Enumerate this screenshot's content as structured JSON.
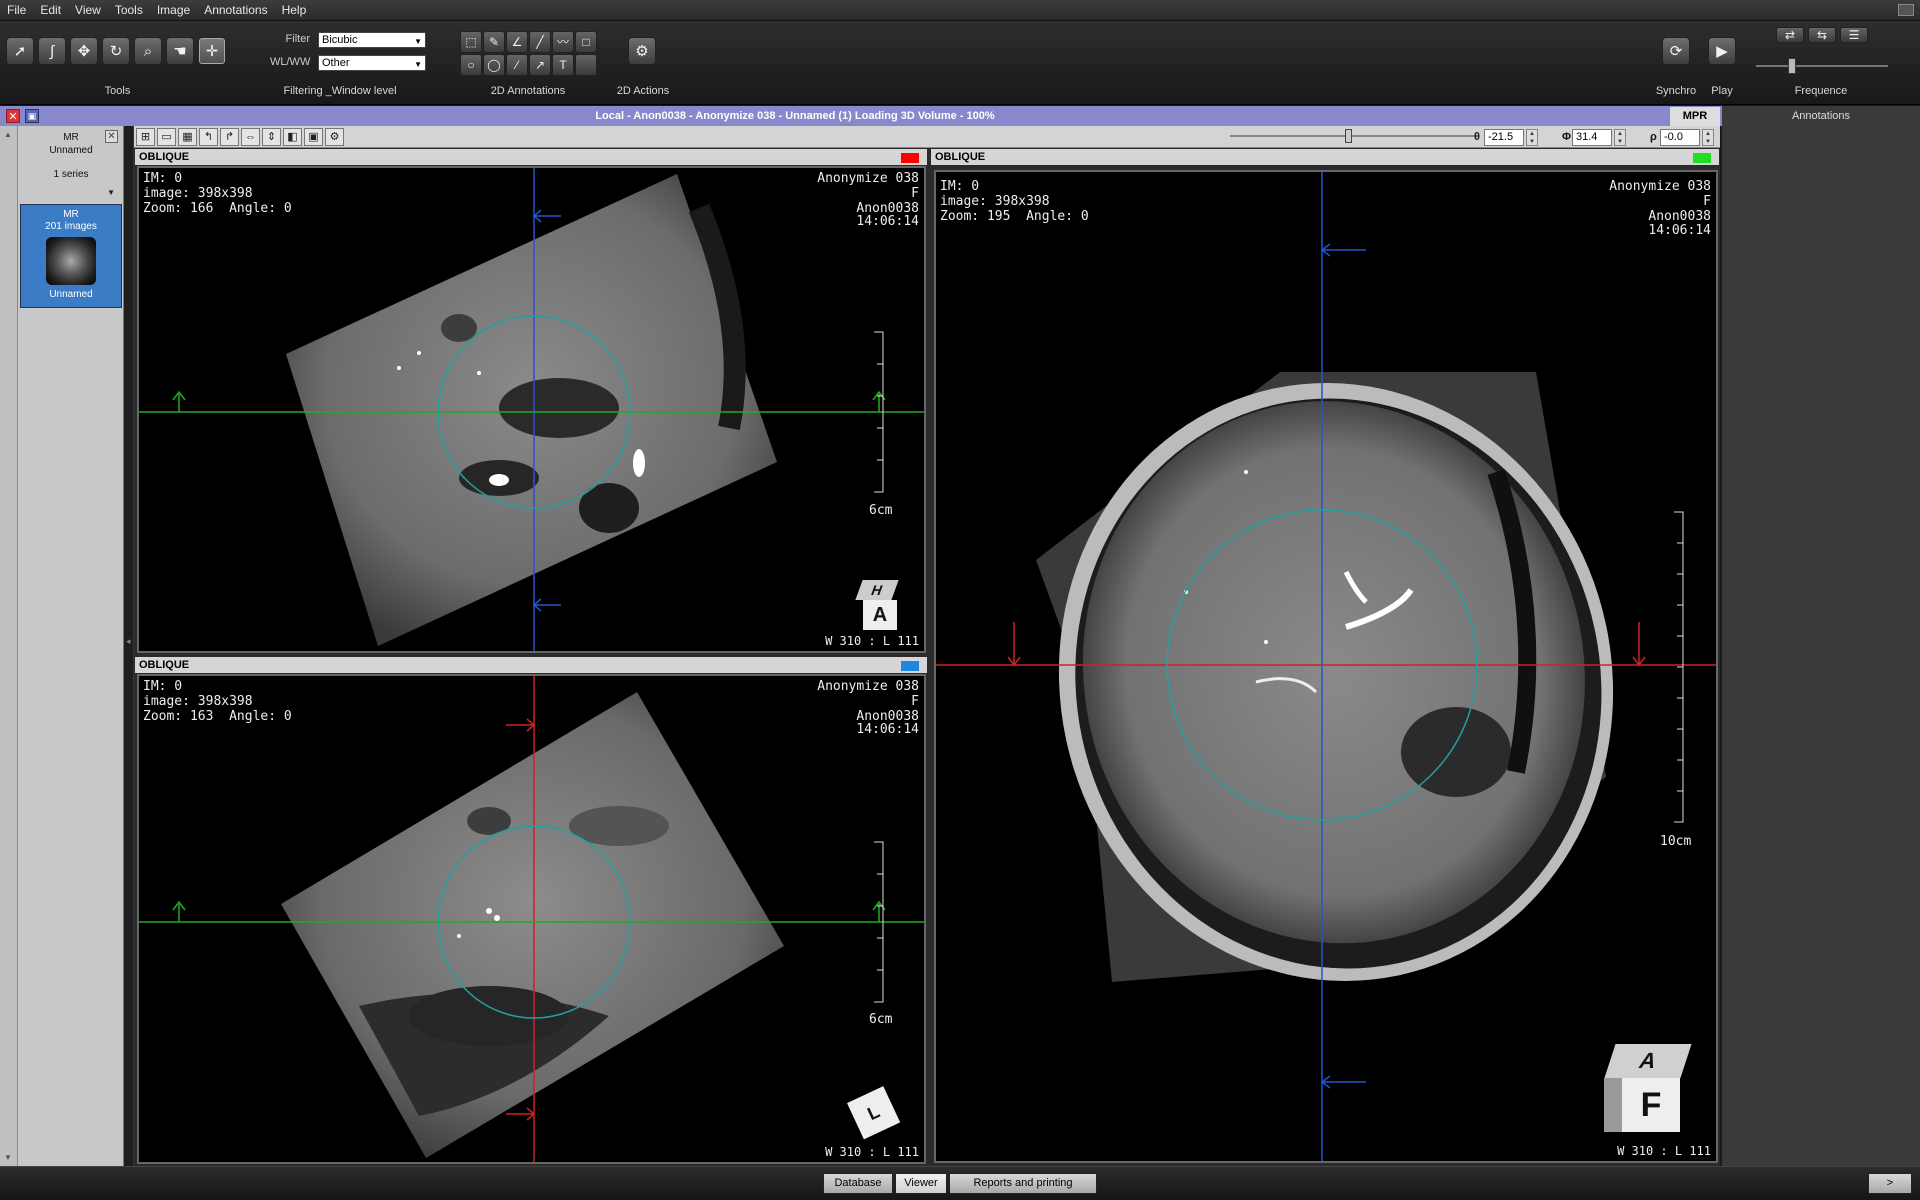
{
  "menu": [
    "File",
    "Edit",
    "View",
    "Tools",
    "Image",
    "Annotations",
    "Help"
  ],
  "toolbar": {
    "tools_label": "Tools",
    "filtering_label": "Filtering _Window level",
    "annotations_label": "2D Annotations",
    "actions_label": "2D Actions",
    "synchro_label": "Synchro",
    "play_label": "Play",
    "frequence_label": "Frequence",
    "filter_label": "Filter",
    "filter_value": "Bicubic",
    "wlww_label": "WL/WW",
    "wlww_value": "Other"
  },
  "window": {
    "title": "Local - Anon0038 - Anonymize 038 - Unnamed (1) Loading 3D Volume - 100%",
    "mpr_tab": "MPR",
    "annotations_tab": "Annotations"
  },
  "series_panel": {
    "modality": "MR",
    "name": "Unnamed",
    "count": "1 series",
    "thumb_modality": "MR",
    "thumb_images": "201 images",
    "thumb_name": "Unnamed"
  },
  "angles": {
    "theta_label": "θ",
    "theta_value": "-21.5",
    "phi_label": "Φ",
    "phi_value": "31.4",
    "rho_label": "ρ",
    "rho_value": "-0.0"
  },
  "viewports": [
    {
      "name": "OBLIQUE",
      "color": "#ff0000",
      "im": "IM: 0",
      "image": "image: 398x398",
      "zoom": "Zoom: 166  Angle: 0",
      "patient": "Anonymize 038",
      "sex": "F",
      "id": "Anon0038",
      "time": "14:06:14",
      "scale": "6cm",
      "wl": "W 310 : L 111",
      "cube_top": "H",
      "cube_front": "A"
    },
    {
      "name": "OBLIQUE",
      "color": "#1e88e0",
      "im": "IM: 0",
      "image": "image: 398x398",
      "zoom": "Zoom: 163  Angle: 0",
      "patient": "Anonymize 038",
      "sex": "F",
      "id": "Anon0038",
      "time": "14:06:14",
      "scale": "6cm",
      "wl": "W 310 : L 111",
      "cube_top": "L",
      "cube_front": ""
    },
    {
      "name": "OBLIQUE",
      "color": "#22dd22",
      "im": "IM: 0",
      "image": "image: 398x398",
      "zoom": "Zoom: 195  Angle: 0",
      "patient": "Anonymize 038",
      "sex": "F",
      "id": "Anon0038",
      "time": "14:06:14",
      "scale": "10cm",
      "wl": "W 310 : L 111",
      "cube_top": "A",
      "cube_front": "F"
    }
  ],
  "bottom_tabs": {
    "database": "Database",
    "viewer": "Viewer",
    "reports": "Reports and printing",
    "more": ">"
  }
}
